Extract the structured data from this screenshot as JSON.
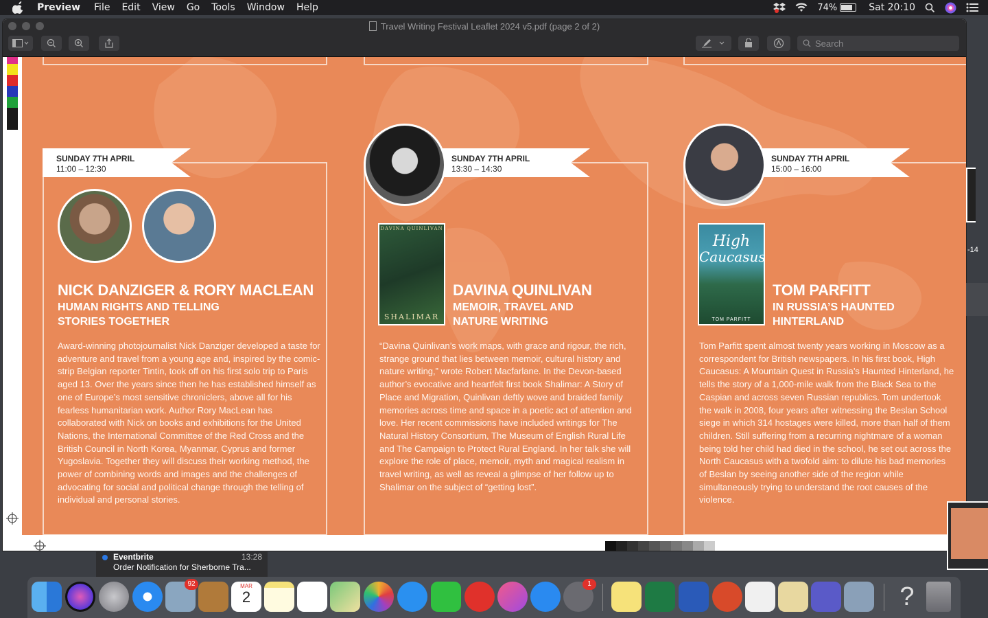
{
  "menubar": {
    "app": "Preview",
    "items": [
      "File",
      "Edit",
      "View",
      "Go",
      "Tools",
      "Window",
      "Help"
    ],
    "battery": "74%",
    "clock": "Sat 20:10"
  },
  "window": {
    "title": "Travel Writing Festival Leaflet 2024 v5.pdf (page 2 of 2)",
    "search_placeholder": "Search"
  },
  "events": [
    {
      "date": "SUNDAY 7TH APRIL",
      "time": "11:00 – 12:30",
      "name": "NICK DANZIGER & RORY MACLEAN",
      "sub1": "HUMAN RIGHTS AND TELLING",
      "sub2": "STORIES TOGETHER",
      "body": "Award-winning photojournalist Nick Danziger developed a taste for adventure and travel from a young age and, inspired by the comic-strip Belgian reporter Tintin, took off on his first solo trip to Paris aged 13. Over the years since then he has established himself as one of Europe’s most sensitive chroniclers, above all for his fearless humanitarian work. Author Rory MacLean has collaborated with Nick on books and exhibitions for the United Nations, the International Committee of the Red Cross and the British Council in North Korea, Myanmar, Cyprus and former Yugoslavia. Together they will discuss their working method, the power of combining words and images and the challenges of advocating for social and political change through the telling of individual and personal stories."
    },
    {
      "date": "SUNDAY 7TH APRIL",
      "time": "13:30 – 14:30",
      "name": "DAVINA QUINLIVAN",
      "sub1": "MEMOIR, TRAVEL AND",
      "sub2": "NATURE WRITING",
      "cover_title": "SHALIMAR",
      "cover_author": "DAVINA QUINLIVAN",
      "body": "“Davina Quinlivan’s work maps, with grace and rigour, the rich, strange ground that lies between memoir, cultural history and nature writing,” wrote Robert Macfarlane. In the Devon-based author’s evocative and heartfelt first book Shalimar: A Story of Place and Migration, Quinlivan deftly wove and braided family memories across time and space in a poetic act of attention and love. Her recent commissions have included writings for The Natural History Consortium, The Museum of English Rural Life and The Campaign to Protect Rural England. In her talk she will explore the role of place, memoir, myth and magical realism in travel writing, as well as reveal a glimpse of her follow up to Shalimar on the subject of “getting lost”."
    },
    {
      "date": "SUNDAY 7TH APRIL",
      "time": "15:00 – 16:00",
      "name": "TOM PARFITT",
      "sub1": "IN RUSSIA’S HAUNTED",
      "sub2": "HINTERLAND",
      "cover_title1": "High",
      "cover_title2": "Caucasus",
      "cover_author": "TOM PARFITT",
      "body": "Tom Parfitt spent almost twenty years working in Moscow as a correspondent for British newspapers. In his first book, High Caucasus: A Mountain Quest in Russia’s Haunted Hinterland, he tells the story of a 1,000-mile walk from the Black Sea to the Caspian and across seven Russian republics. Tom undertook the walk in 2008, four years after witnessing the Beslan School siege in which 314 hostages were killed, more than half of them children. Still suffering from a recurring nightmare of a woman being told her child had died in the school, he set out across the North Caucasus with a twofold aim: to dilute his bad memories of Beslan by seeing another side of the region while simultaneously trying to understand the root causes of the violence."
    }
  ],
  "side_label": "-14",
  "notification": {
    "app": "Eventbrite",
    "time": "13:28",
    "message": "Order Notification for Sherborne Tra..."
  },
  "dock": {
    "mail_badge": "92",
    "calendar_month": "MAR",
    "calendar_day": "2",
    "prefs_badge": "1",
    "help_glyph": "?"
  },
  "colors": {
    "page_orange": "#e98958",
    "menubar": "#1f1f22"
  }
}
